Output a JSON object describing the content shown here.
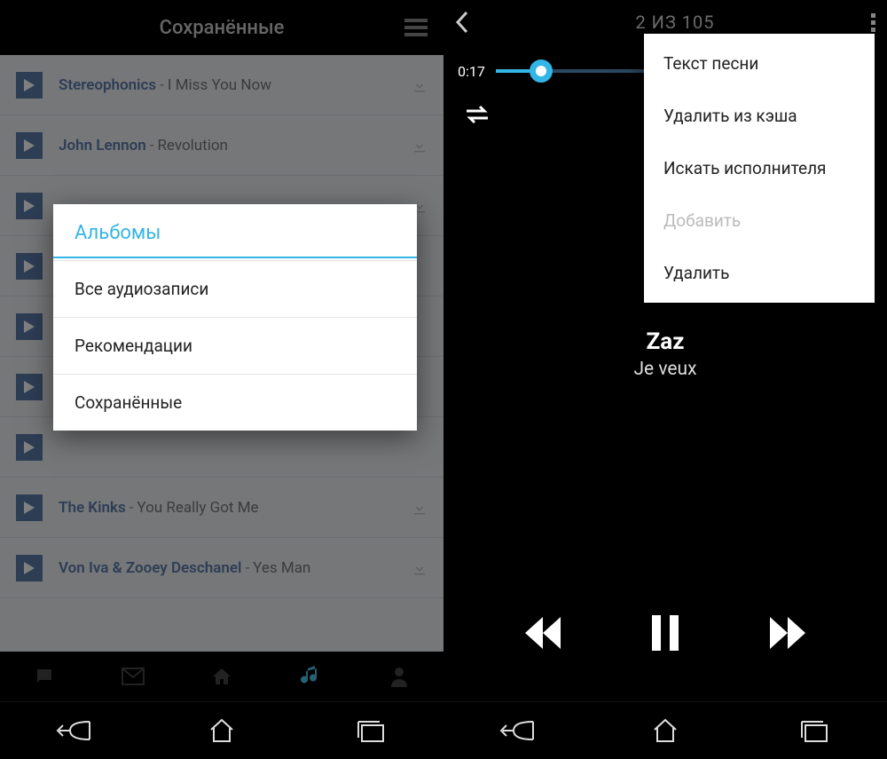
{
  "left": {
    "header_title": "Сохранённые",
    "tracks": [
      {
        "artist": "Stereophonics",
        "title": "I Miss You Now"
      },
      {
        "artist": "John Lennon",
        "title": "Revolution"
      },
      {
        "artist": "",
        "title": ""
      },
      {
        "artist": "",
        "title": ""
      },
      {
        "artist": "",
        "title": ""
      },
      {
        "artist": "",
        "title": ""
      },
      {
        "artist": "",
        "title": ""
      },
      {
        "artist": "The Kinks",
        "title": "You Really Got Me"
      },
      {
        "artist": "Von Iva &  Zooey Deschanel",
        "title": "Yes Man"
      }
    ],
    "dialog": {
      "title": "Альбомы",
      "items": [
        "Все аудиозаписи",
        "Рекомендации",
        "Сохранённые"
      ]
    }
  },
  "right": {
    "top_counter": "2 ИЗ 105",
    "seek_time": "0:17",
    "artist": "Zaz",
    "song": "Je veux",
    "context_menu": [
      {
        "label": "Текст песни",
        "disabled": false
      },
      {
        "label": "Удалить из кэша",
        "disabled": false
      },
      {
        "label": "Искать исполнителя",
        "disabled": false
      },
      {
        "label": "Добавить",
        "disabled": true
      },
      {
        "label": "Удалить",
        "disabled": false
      }
    ]
  },
  "colors": {
    "accent": "#33b5e5",
    "link": "#5a7aa9"
  }
}
